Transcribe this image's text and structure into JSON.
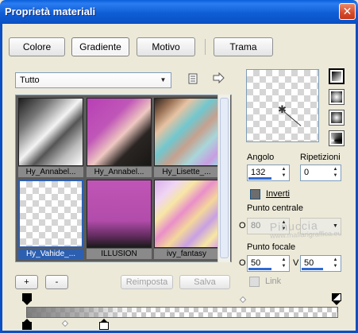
{
  "window": {
    "title": "Proprietà materiali",
    "close_glyph": "✕"
  },
  "tabs": [
    {
      "label": "Colore"
    },
    {
      "label": "Gradiente",
      "active": true
    },
    {
      "label": "Motivo"
    },
    {
      "label": "Trama"
    }
  ],
  "category": {
    "selected": "Tutto"
  },
  "gradients": [
    {
      "label": "Hy_Annabel..."
    },
    {
      "label": "Hy_Annabel..."
    },
    {
      "label": "Hy_Lisette_..."
    },
    {
      "label": "Hy_Vahide_...",
      "selected": true
    },
    {
      "label": "ILLUSION"
    },
    {
      "label": "ivy_fantasy"
    }
  ],
  "params": {
    "angle_label": "Angolo",
    "angle_value": "132",
    "repeat_label": "Ripetizioni",
    "repeat_value": "0",
    "invert_label": "Inverti",
    "center_label": "Punto centrale",
    "center_x": "80",
    "focal_label": "Punto focale",
    "focal_x": "50",
    "focal_y": "50",
    "o_label": "O",
    "v_label": "V",
    "link_label": "Link"
  },
  "watermark": {
    "line1": "Pinuccia",
    "line2": "www.mafiarigraffica.eu"
  },
  "buttons": {
    "add": "+",
    "remove": "-",
    "reset": "Reimposta",
    "save": "Salva"
  }
}
